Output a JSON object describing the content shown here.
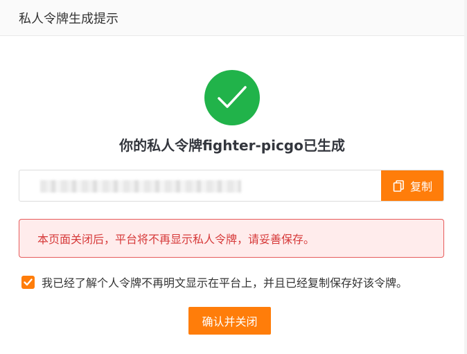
{
  "dialog": {
    "title": "私人令牌生成提示",
    "headline": "你的私人令牌fighter-picgo已生成",
    "token": {
      "copy_label": "复制"
    },
    "warning_text": "本页面关闭后，平台将不再显示私人令牌，请妥善保存。",
    "acknowledge": {
      "label": "我已经了解个人令牌不再明文显示在平台上，并且已经复制保存好该令牌。",
      "checked": true
    },
    "confirm_label": "确认并关闭"
  },
  "colors": {
    "accent": "#ff7d0a",
    "success": "#21b34a",
    "warning_text": "#d63939",
    "warning_bg": "#ffecec"
  },
  "icons": {
    "success": "check-circle-icon",
    "copy": "copy-icon",
    "checkbox": "check-icon"
  }
}
